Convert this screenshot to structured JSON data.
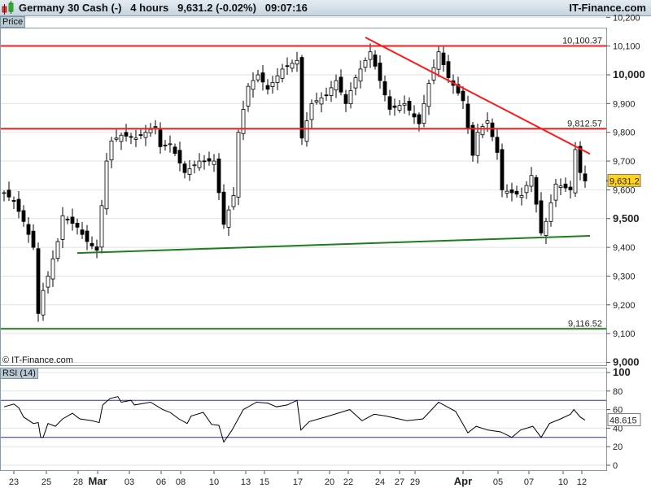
{
  "header": {
    "title": "Germany 30 Cash (-)",
    "timeframe": "4 hours",
    "last": "9,631.2 (-0.02%)",
    "time": "09:07:16",
    "brand": "IT-Finance.com"
  },
  "price_tag": "Price",
  "rsi_tag": "RSI (14)",
  "copyright": "© IT-Finance.com",
  "colors": {
    "support": "#1e7d1e",
    "resistance": "#ff1a1a",
    "rsi_band": "#2a2ab0",
    "current": "#ffd21e"
  },
  "chart_data": [
    {
      "type": "candlestick",
      "title": "Germany 30 Cash (-) 4 hours",
      "ylim": [
        9000,
        10200
      ],
      "yticks": [
        "9,000",
        "9,100",
        "9,200",
        "9,300",
        "9,400",
        "9,500",
        "9,600",
        "9,700",
        "9,800",
        "9,900",
        "10,000",
        "10,100",
        "10,200"
      ],
      "xticks": [
        "23",
        "25",
        "28",
        "Mar",
        "03",
        "06",
        "08",
        "10",
        "13",
        "15",
        "17",
        "20",
        "22",
        "24",
        "27",
        "29",
        "Apr",
        "05",
        "07",
        "10",
        "12"
      ],
      "price_path": [
        [
          0,
          9590
        ],
        [
          2,
          9560
        ],
        [
          4,
          9490
        ],
        [
          6,
          9400
        ],
        [
          7,
          9170
        ],
        [
          8,
          9250
        ],
        [
          9,
          9300
        ],
        [
          11,
          9420
        ],
        [
          12,
          9510
        ],
        [
          15,
          9470
        ],
        [
          17,
          9420
        ],
        [
          19,
          9390
        ],
        [
          21,
          9700
        ],
        [
          22,
          9770
        ],
        [
          24,
          9790
        ],
        [
          27,
          9780
        ],
        [
          31,
          9820
        ],
        [
          32,
          9750
        ],
        [
          34,
          9760
        ],
        [
          37,
          9660
        ],
        [
          40,
          9700
        ],
        [
          43,
          9700
        ],
        [
          45,
          9480
        ],
        [
          47,
          9580
        ],
        [
          48,
          9800
        ],
        [
          50,
          9960
        ],
        [
          52,
          10000
        ],
        [
          54,
          9950
        ],
        [
          57,
          10020
        ],
        [
          60,
          10050
        ],
        [
          61,
          9780
        ],
        [
          63,
          9900
        ],
        [
          66,
          9930
        ],
        [
          68,
          9980
        ],
        [
          70,
          9900
        ],
        [
          72,
          9990
        ],
        [
          75,
          10080
        ],
        [
          77,
          9980
        ],
        [
          79,
          9880
        ],
        [
          82,
          9900
        ],
        [
          85,
          9830
        ],
        [
          87,
          9970
        ],
        [
          89,
          10080
        ],
        [
          91,
          9990
        ],
        [
          94,
          9910
        ],
        [
          96,
          9720
        ],
        [
          97,
          9800
        ],
        [
          99,
          9840
        ],
        [
          101,
          9730
        ],
        [
          102,
          9600
        ],
        [
          106,
          9580
        ],
        [
          108,
          9650
        ],
        [
          110,
          9450
        ],
        [
          111,
          9490
        ],
        [
          113,
          9620
        ],
        [
          116,
          9600
        ],
        [
          117,
          9740
        ],
        [
          118,
          9660
        ],
        [
          119,
          9631
        ]
      ],
      "annotations": [
        {
          "label": "10,100.37",
          "value": 10100.37,
          "kind": "resistance"
        },
        {
          "label": "9,812.57",
          "value": 9812.57,
          "kind": "resistance"
        },
        {
          "label": "9,116.52",
          "value": 9116.52,
          "kind": "support"
        },
        {
          "label": "9,631.2",
          "value": 9631.2,
          "kind": "current"
        }
      ],
      "trendlines": [
        {
          "kind": "resistance",
          "from": [
            74,
            10130
          ],
          "to": [
            120,
            9725
          ]
        },
        {
          "kind": "support",
          "from": [
            15,
            9380
          ],
          "to": [
            120,
            9440
          ]
        }
      ]
    },
    {
      "type": "line",
      "title": "RSI (14)",
      "ylim": [
        0,
        100
      ],
      "yticks": [
        "0",
        "20",
        "40",
        "60",
        "80",
        "100"
      ],
      "bands": [
        30,
        70
      ],
      "current": "48.615",
      "path": [
        [
          0,
          63
        ],
        [
          2,
          66
        ],
        [
          3,
          62
        ],
        [
          4,
          52
        ],
        [
          6,
          45
        ],
        [
          7,
          46
        ],
        [
          7.5,
          30
        ],
        [
          8,
          30
        ],
        [
          9,
          45
        ],
        [
          10.5,
          42
        ],
        [
          12,
          50
        ],
        [
          14,
          56
        ],
        [
          15.5,
          50
        ],
        [
          18,
          48
        ],
        [
          19.5,
          46
        ],
        [
          20.2,
          65
        ],
        [
          21.7,
          72
        ],
        [
          23.3,
          74
        ],
        [
          24,
          68
        ],
        [
          26,
          70
        ],
        [
          26.7,
          65
        ],
        [
          30,
          68
        ],
        [
          32.5,
          60
        ],
        [
          34,
          57
        ],
        [
          35.8,
          50
        ],
        [
          37.5,
          45
        ],
        [
          38.3,
          53
        ],
        [
          40.8,
          57
        ],
        [
          42.5,
          44
        ],
        [
          44,
          43
        ],
        [
          45,
          25
        ],
        [
          46.7,
          38
        ],
        [
          49,
          60
        ],
        [
          51.7,
          68
        ],
        [
          54,
          67
        ],
        [
          55.8,
          63
        ],
        [
          58,
          65
        ],
        [
          60,
          70
        ],
        [
          60.8,
          38
        ],
        [
          62.5,
          47
        ],
        [
          65.8,
          52
        ],
        [
          70.8,
          60
        ],
        [
          73.3,
          48
        ],
        [
          75.8,
          55
        ],
        [
          78.3,
          53
        ],
        [
          82.5,
          48
        ],
        [
          85.8,
          50
        ],
        [
          89,
          68
        ],
        [
          92.5,
          58
        ],
        [
          95,
          35
        ],
        [
          96.7,
          42
        ],
        [
          99,
          38
        ],
        [
          101.7,
          36
        ],
        [
          104,
          30
        ],
        [
          105.8,
          38
        ],
        [
          108.3,
          42
        ],
        [
          110,
          30
        ],
        [
          111.7,
          45
        ],
        [
          114,
          50
        ],
        [
          116,
          55
        ],
        [
          116.7,
          60
        ],
        [
          118,
          52
        ],
        [
          119,
          48.6
        ]
      ]
    }
  ]
}
